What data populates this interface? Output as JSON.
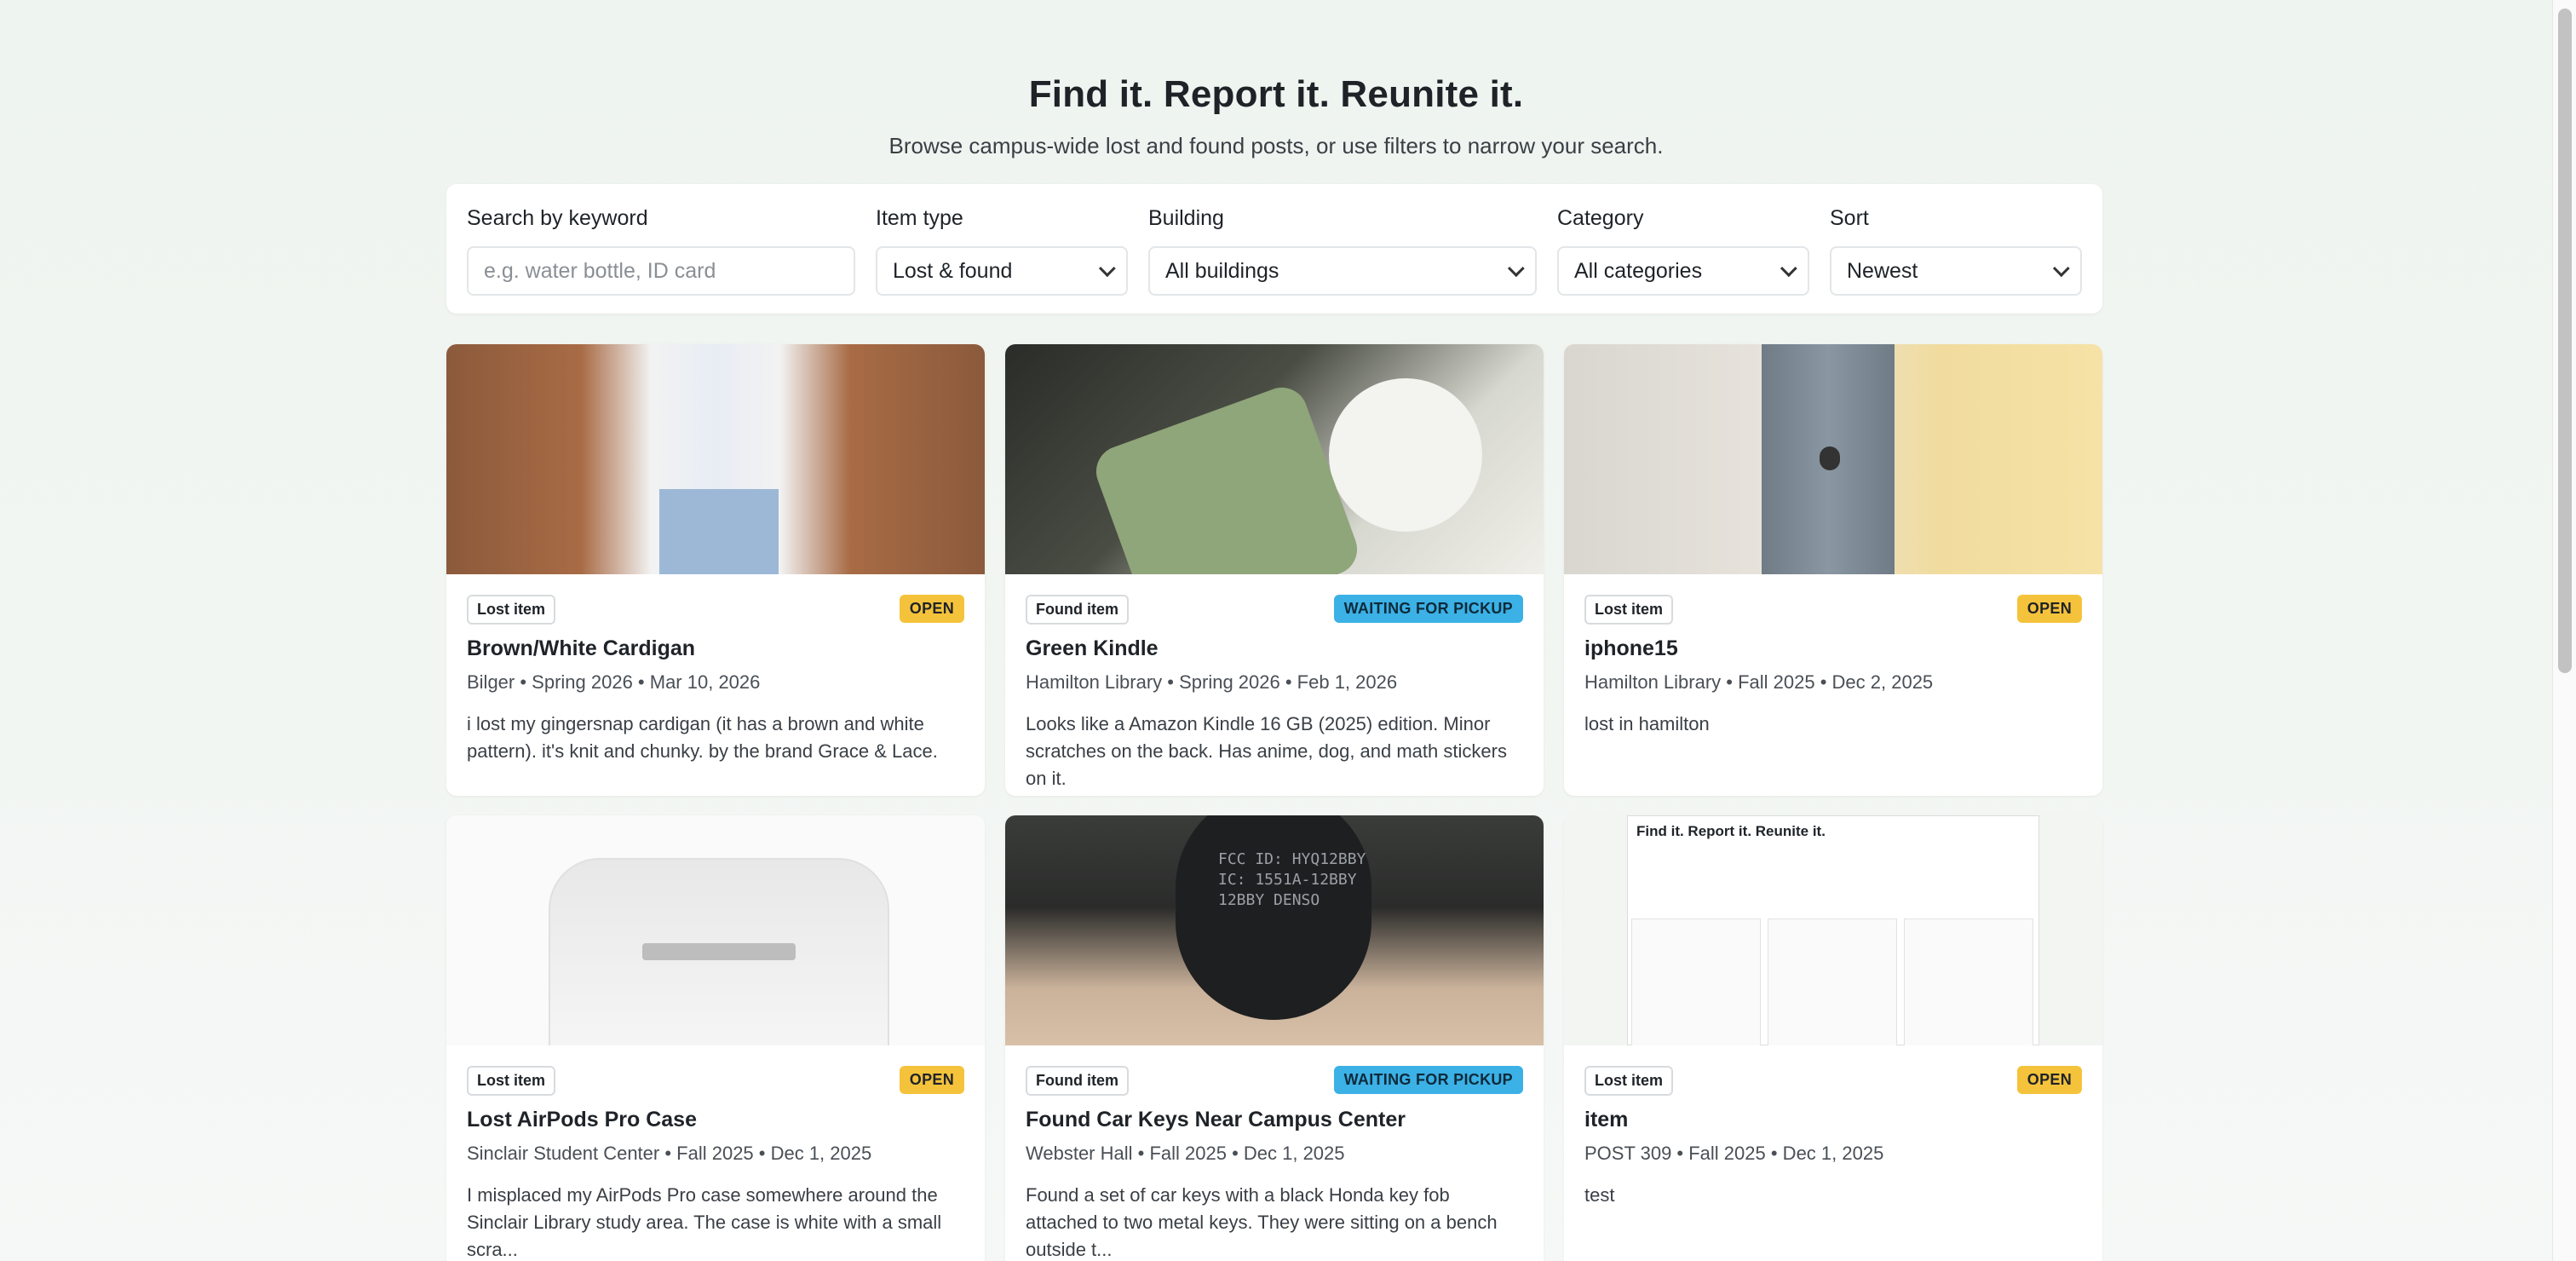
{
  "hero": {
    "title": "Find it. Report it. Reunite it.",
    "subtitle": "Browse campus-wide lost and found posts, or use filters to narrow your search."
  },
  "filters": {
    "keyword_label": "Search by keyword",
    "keyword_placeholder": "e.g. water bottle, ID card",
    "type_label": "Item type",
    "type_value": "Lost & found",
    "building_label": "Building",
    "building_value": "All buildings",
    "category_label": "Category",
    "category_value": "All categories",
    "sort_label": "Sort",
    "sort_value": "Newest"
  },
  "cards": [
    {
      "type": "Lost item",
      "status": "OPEN",
      "title": "Brown/White Cardigan",
      "meta": "Bilger • Spring 2026 • Mar 10, 2026",
      "desc": "i lost my gingersnap cardigan (it has a brown and white pattern). it's knit and chunky. by the brand Grace & Lace."
    },
    {
      "type": "Found item",
      "status": "WAITING FOR PICKUP",
      "title": "Green Kindle",
      "meta": "Hamilton Library • Spring 2026 • Feb 1, 2026",
      "desc": "Looks like a Amazon Kindle 16 GB (2025) edition. Minor scratches on the back. Has anime, dog, and math stickers on it."
    },
    {
      "type": "Lost item",
      "status": "OPEN",
      "title": "iphone15",
      "meta": "Hamilton Library • Fall 2025 • Dec 2, 2025",
      "desc": "lost in hamilton"
    },
    {
      "type": "Lost item",
      "status": "OPEN",
      "title": "Lost AirPods Pro Case",
      "meta": "Sinclair Student Center • Fall 2025 • Dec 1, 2025",
      "desc": "I misplaced my AirPods Pro case somewhere around the Sinclair Library study area. The case is white with a small scra..."
    },
    {
      "type": "Found item",
      "status": "WAITING FOR PICKUP",
      "title": "Found Car Keys Near Campus Center",
      "meta": "Webster Hall • Fall 2025 • Dec 1, 2025",
      "desc": "Found a set of car keys with a black Honda key fob attached to two metal keys. They were sitting on a bench outside t..."
    },
    {
      "type": "Lost item",
      "status": "OPEN",
      "title": "item",
      "meta": "POST 309 • Fall 2025 • Dec 1, 2025",
      "desc": "test"
    }
  ],
  "photo_text": {
    "keys_fob": "FCC ID: HYQ12BBY\nIC: 1551A-12BBY\n12BBY DENSO",
    "mini_title": "Find it. Report it. Reunite it."
  }
}
